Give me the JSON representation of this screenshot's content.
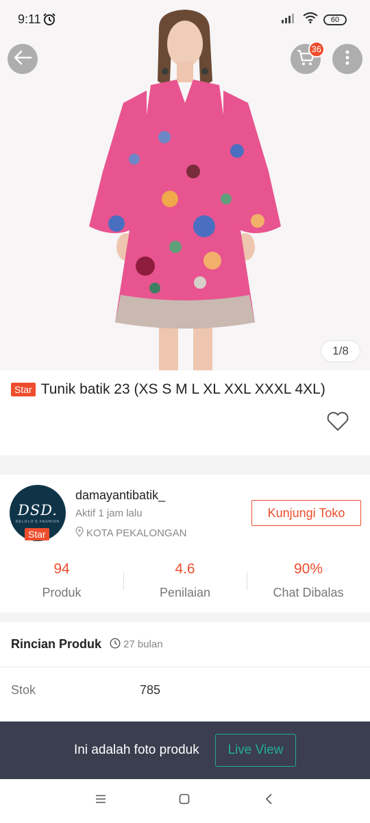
{
  "status_bar": {
    "time": "9:11",
    "battery": "60"
  },
  "header": {
    "cart_count": "36"
  },
  "gallery": {
    "counter": "1/8"
  },
  "product": {
    "badge": "Star",
    "title": "Tunik batik 23 (XS S M L XL XXL XXXL 4XL)"
  },
  "shop": {
    "avatar_text": "DSD.",
    "avatar_subtext": "RELOLO'S FASHION",
    "badge": "Star",
    "name": "damayantibatik_",
    "active": "Aktif 1 jam lalu",
    "location": "KOTA PEKALONGAN",
    "visit_label": "Kunjungi Toko",
    "stats": [
      {
        "value": "94",
        "label": "Produk"
      },
      {
        "value": "4.6",
        "label": "Penilaian"
      },
      {
        "value": "90%",
        "label": "Chat Dibalas"
      }
    ]
  },
  "details": {
    "title": "Rincian Produk",
    "time": "27 bulan",
    "stock_label": "Stok",
    "stock_value": "785"
  },
  "banner": {
    "text": "Ini adalah foto produk",
    "live_label": "Live View"
  },
  "colors": {
    "accent": "#ee4d2d",
    "teal": "#26aa99",
    "banner_bg": "#3a3e4f",
    "dress_pink": "#e8548f"
  },
  "icons": [
    "alarm-icon",
    "signal-icon",
    "wifi-icon",
    "battery-icon",
    "back-arrow-icon",
    "cart-icon",
    "more-vertical-icon",
    "heart-icon",
    "location-pin-icon",
    "clock-icon",
    "menu-icon",
    "home-square-icon",
    "back-chevron-icon"
  ]
}
